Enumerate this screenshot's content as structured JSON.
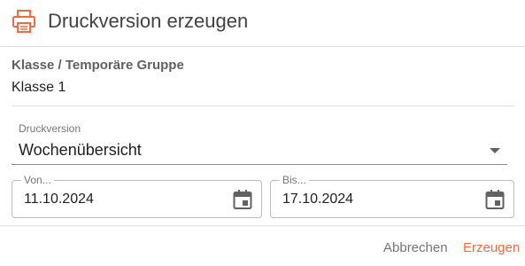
{
  "dialog": {
    "title": "Druckversion erzeugen",
    "icon": "printer-icon",
    "accent_color": "#f06b3e"
  },
  "group": {
    "label": "Klasse / Temporäre Gruppe",
    "value": "Klasse 1"
  },
  "print_version": {
    "label": "Druckversion",
    "selected": "Wochenübersicht"
  },
  "date_from": {
    "label": "Von...",
    "value": "11.10.2024",
    "icon": "calendar-icon"
  },
  "date_to": {
    "label": "Bis...",
    "value": "17.10.2024",
    "icon": "calendar-icon"
  },
  "actions": {
    "cancel_label": "Abbrechen",
    "submit_label": "Erzeugen"
  }
}
